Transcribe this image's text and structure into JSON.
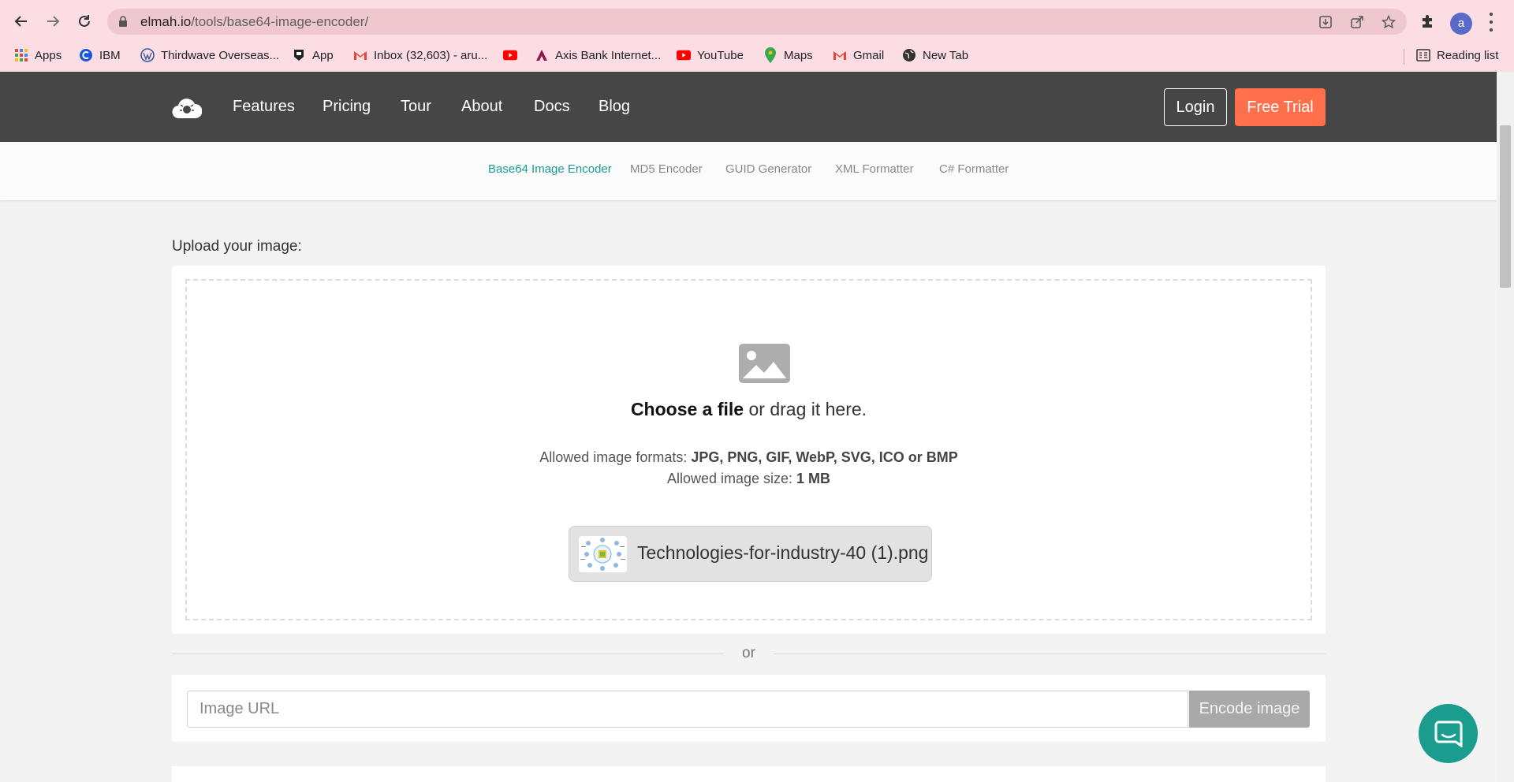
{
  "browser": {
    "url_domain": "elmah.io",
    "url_path": "/tools/base64-image-encoder/",
    "profile_initial": "a",
    "bookmarks": [
      {
        "label": "Apps",
        "icon": "apps-grid-icon"
      },
      {
        "label": "IBM",
        "icon": "ibm-icon"
      },
      {
        "label": "Thirdwave Overseas...",
        "icon": "wordpress-icon"
      },
      {
        "label": "App",
        "icon": "app-icon"
      },
      {
        "label": "Inbox (32,603) - aru...",
        "icon": "gmail-icon"
      },
      {
        "label": "",
        "icon": "youtube-icon"
      },
      {
        "label": "Axis Bank Internet...",
        "icon": "axis-bank-icon"
      },
      {
        "label": "YouTube",
        "icon": "youtube-icon"
      },
      {
        "label": "Maps",
        "icon": "maps-icon"
      },
      {
        "label": "Gmail",
        "icon": "gmail-icon"
      },
      {
        "label": "New Tab",
        "icon": "globe-icon"
      }
    ],
    "reading_list": "Reading list"
  },
  "header": {
    "nav": [
      "Features",
      "Pricing",
      "Tour",
      "About",
      "Docs",
      "Blog"
    ],
    "login": "Login",
    "free_trial": "Free Trial"
  },
  "subnav": {
    "items": [
      "Base64 Image Encoder",
      "MD5 Encoder",
      "GUID Generator",
      "XML Formatter",
      "C# Formatter"
    ],
    "active_index": 0
  },
  "upload": {
    "label": "Upload your image:",
    "choose_file": "Choose a file",
    "drag_text": " or drag it here.",
    "formats_label": "Allowed image formats: ",
    "formats_value": "JPG, PNG, GIF, WebP, SVG, ICO or BMP",
    "size_label": "Allowed image size: ",
    "size_value": "1 MB",
    "file_name": "Technologies-for-industry-40 (1).png"
  },
  "separator": "or",
  "url_form": {
    "placeholder": "Image URL",
    "value": "",
    "button": "Encode image"
  },
  "colors": {
    "accent": "#1a9c8f",
    "trial": "#ff6f4b",
    "header_bg": "#464646",
    "chrome_bg": "#fcdde3"
  }
}
